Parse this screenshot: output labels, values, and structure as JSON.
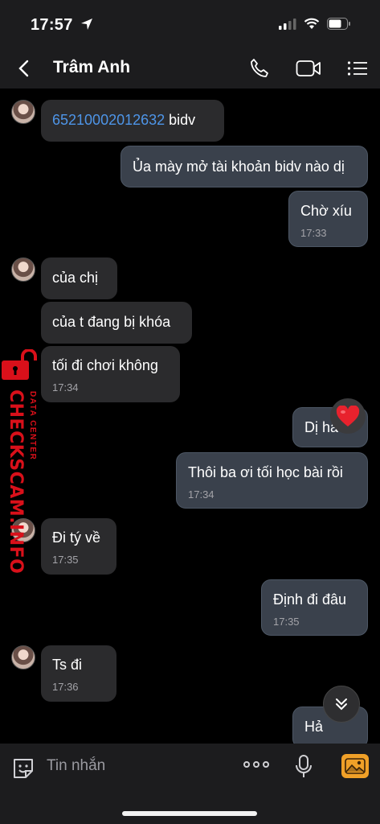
{
  "status_bar": {
    "time": "17:57",
    "icons": [
      "location-arrow-icon",
      "cellular-signal-icon",
      "wifi-icon",
      "battery-icon"
    ]
  },
  "header": {
    "contact_name": "Trâm Anh",
    "icons": [
      "back-chevron-icon",
      "phone-icon",
      "video-camera-icon",
      "list-menu-icon"
    ]
  },
  "messages": [
    {
      "id": "m1",
      "dir": "in",
      "link": "65210002012632",
      "text": " bidv",
      "time": ""
    },
    {
      "id": "m2",
      "dir": "out",
      "text": "Ủa mày mở tài khoản bidv nào dị",
      "time": ""
    },
    {
      "id": "m3",
      "dir": "out",
      "text": "Chờ xíu",
      "time": "17:33"
    },
    {
      "id": "m4",
      "dir": "in",
      "text": "của chị",
      "time": ""
    },
    {
      "id": "m5",
      "dir": "in",
      "text": "của t đang bị khóa",
      "time": ""
    },
    {
      "id": "m6",
      "dir": "in",
      "text": "tối đi chơi không",
      "time": "17:34"
    },
    {
      "id": "m7",
      "dir": "out",
      "text": "Dị hả",
      "time": "",
      "reaction": "heart-icon"
    },
    {
      "id": "m8",
      "dir": "out",
      "text": "Thôi ba ơi tối học bài rồi",
      "time": "17:34"
    },
    {
      "id": "m9",
      "dir": "in",
      "text": "Đi tý về",
      "time": "17:35"
    },
    {
      "id": "m10",
      "dir": "out",
      "text": "Định đi đâu",
      "time": "17:35"
    },
    {
      "id": "m11",
      "dir": "in",
      "text": "Ts đi",
      "time": "17:36"
    },
    {
      "id": "m12",
      "dir": "out",
      "text": "Hả",
      "time": ""
    }
  ],
  "watermark": {
    "main": "CHECKSCAM.INFO",
    "sub": "DATA CENTER"
  },
  "input_bar": {
    "placeholder": "Tin nhắn",
    "icons": [
      "sticker-icon",
      "more-dots-icon",
      "microphone-icon",
      "photo-icon"
    ]
  },
  "colors": {
    "background": "#000000",
    "bar": "#1c1c1e",
    "incoming": "#2b2b2d",
    "outgoing": "#3a414c",
    "link": "#4e95e8",
    "watermark": "#d9101a",
    "photo_accent": "#f0a028"
  }
}
